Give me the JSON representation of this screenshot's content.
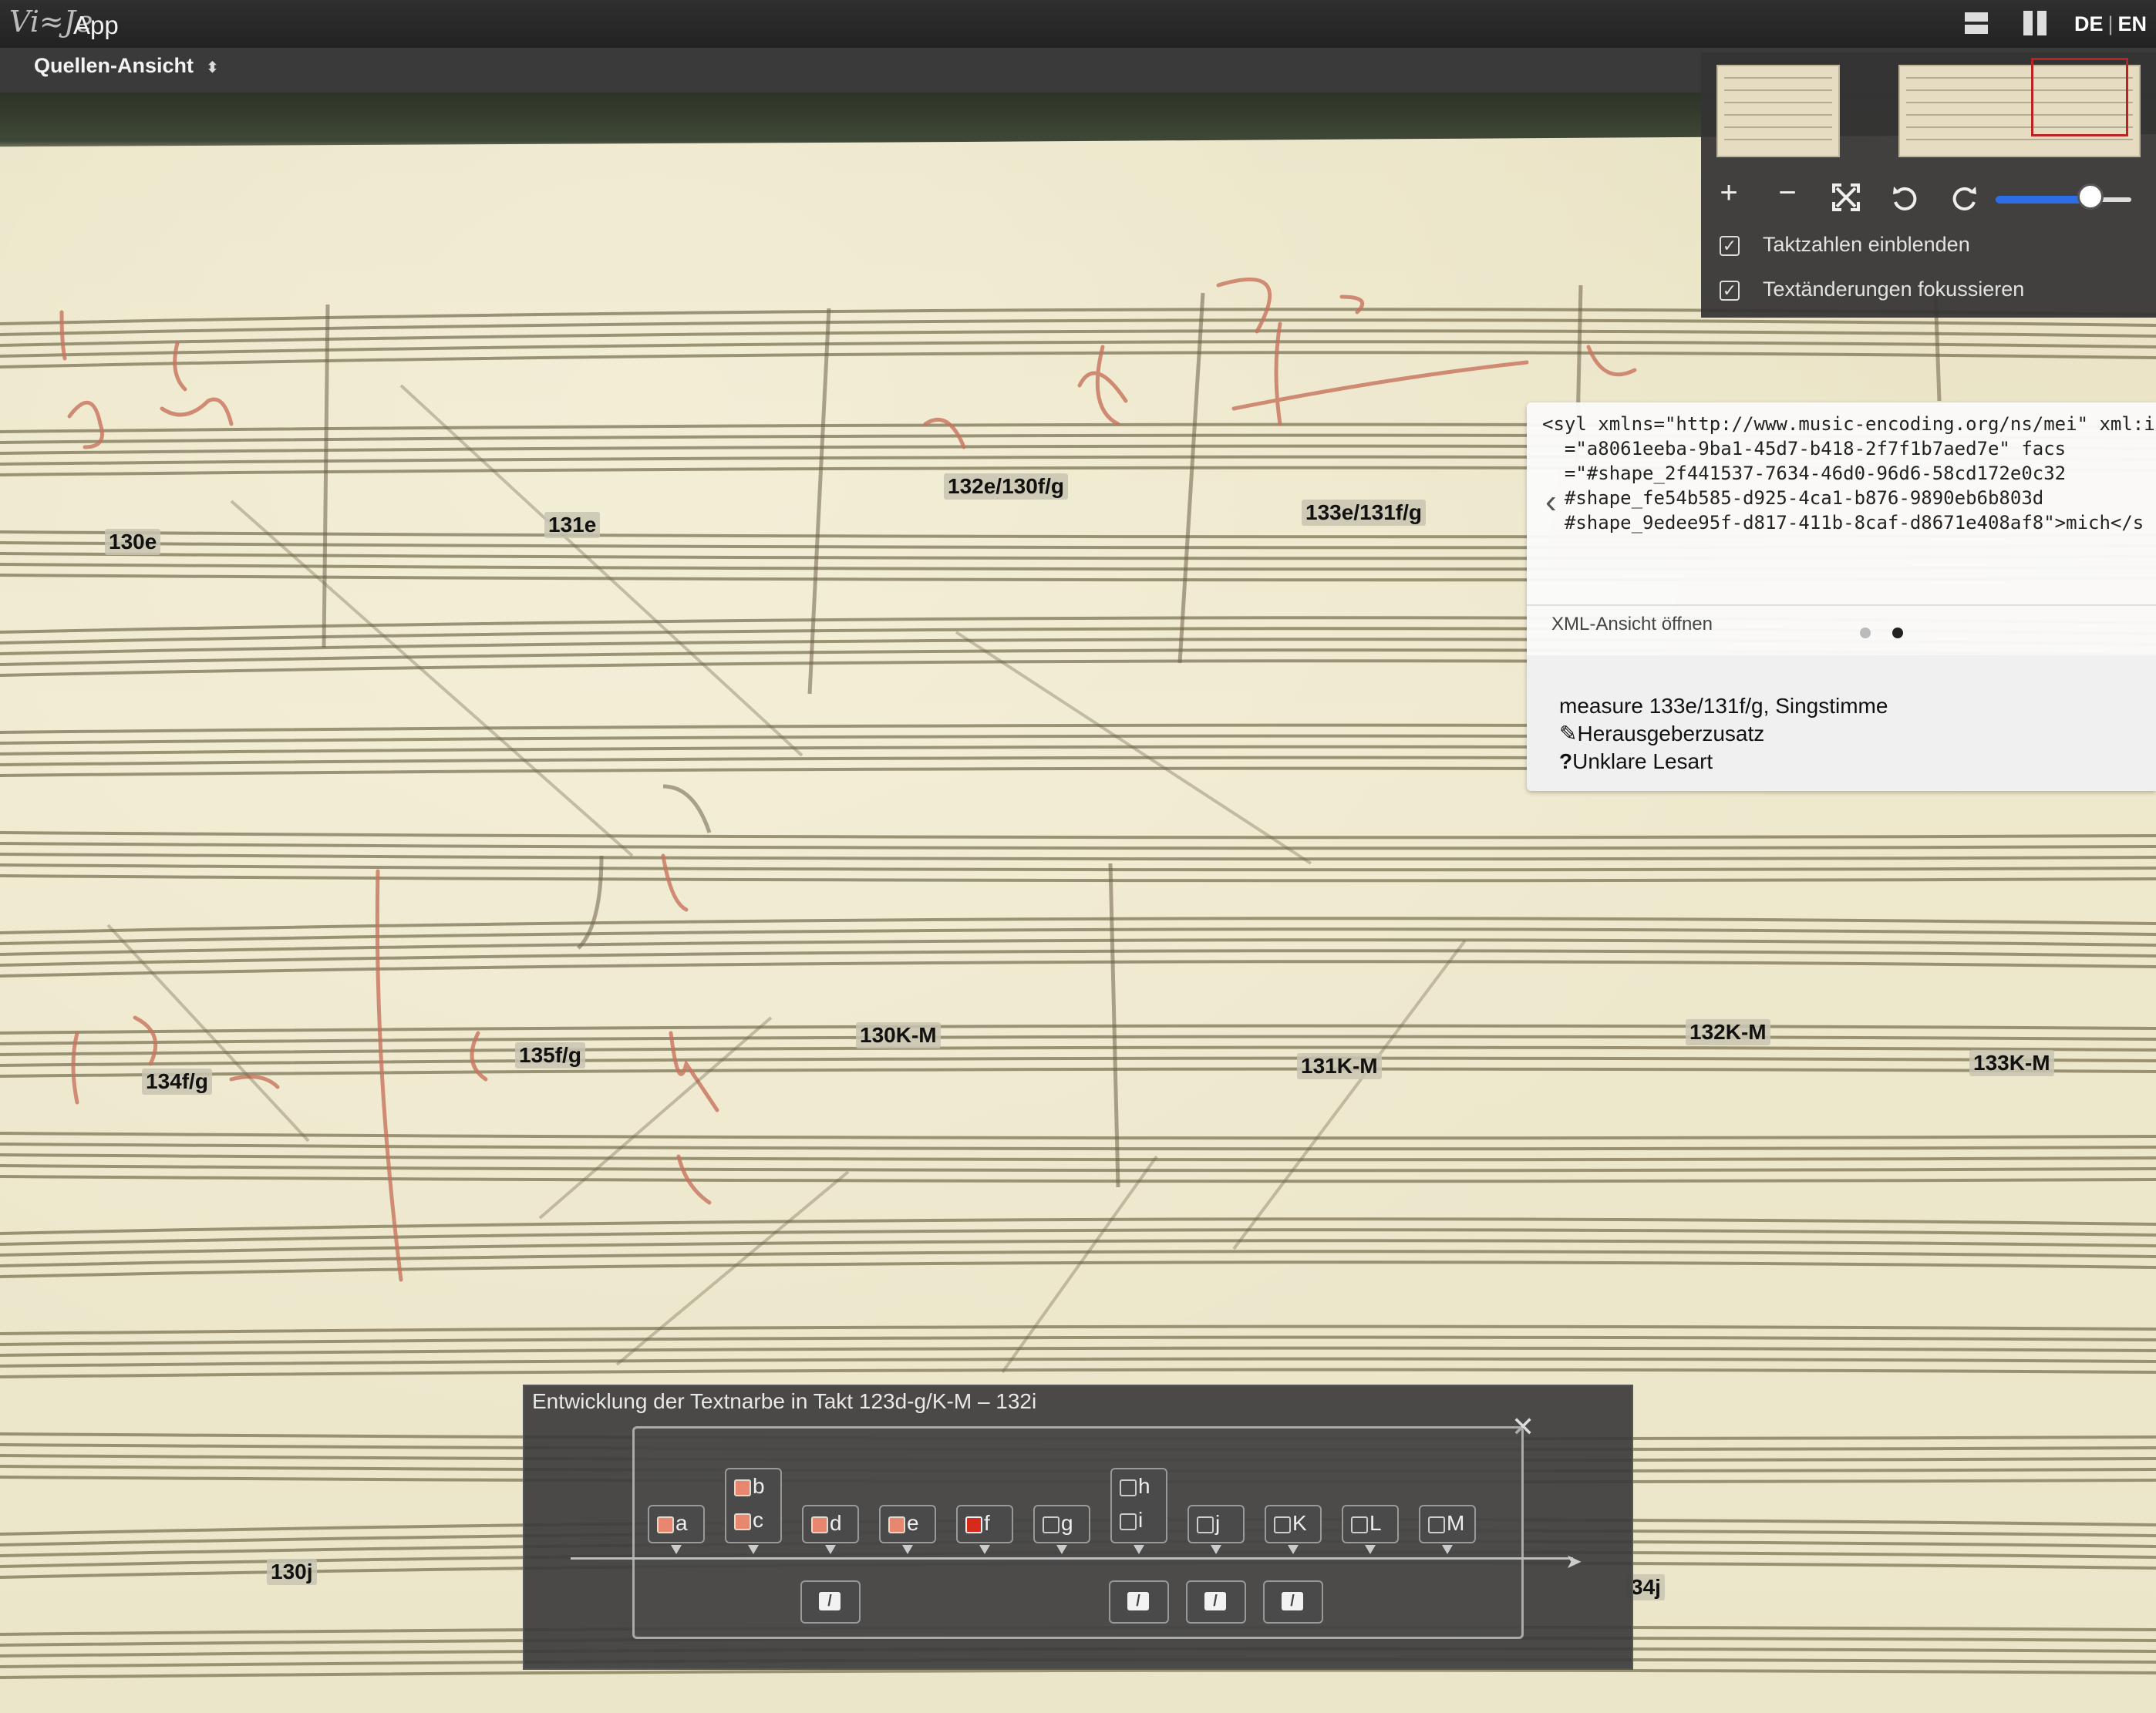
{
  "app": {
    "logo": "Vi≈Je",
    "title": "App"
  },
  "header": {
    "lang_de": "DE",
    "lang_en": "EN",
    "view_select": "Quellen-Ansicht"
  },
  "nav": {
    "checkbox1": "Taktzahlen einblenden",
    "checkbox2": "Textänderungen fokussieren",
    "zoom_level": 0.7
  },
  "measures": [
    {
      "label": "130e"
    },
    {
      "label": "131e"
    },
    {
      "label": "132e/130f/g"
    },
    {
      "label": "133e/131f/g"
    },
    {
      "label": "134f/g"
    },
    {
      "label": "135f/g"
    },
    {
      "label": "130K-M"
    },
    {
      "label": "131K-M"
    },
    {
      "label": "132K-M"
    },
    {
      "label": "133K-M"
    },
    {
      "label": "130j"
    },
    {
      "label": "34j"
    }
  ],
  "xml": {
    "lines": [
      "<syl xmlns=\"http://www.music-encoding.org/ns/mei\" xml:id",
      "  =\"a8061eeba-9ba1-45d7-b418-2f7f1b7aed7e\" facs",
      "  =\"#shape_2f441537-7634-46d0-96d6-58cd172e0c32",
      "  #shape_fe54b585-d925-4ca1-b876-9890eb6b803d",
      "  #shape_9edee95f-d817-411b-8caf-d8671e408af8\">mich</s"
    ],
    "open_label": "XML-Ansicht öffnen",
    "measure_info": "measure 133e/131f/g, Singstimme",
    "note1": "Herausgeberzusatz",
    "note2": "Unklare Lesart"
  },
  "variant": {
    "title": "Entwicklung der Textnarbe in Takt 123d-g/K-M – 132i",
    "nodes": [
      {
        "labels": [
          "a"
        ],
        "states": [
          "fill"
        ]
      },
      {
        "labels": [
          "b",
          "c"
        ],
        "states": [
          "fill",
          "fill"
        ]
      },
      {
        "labels": [
          "d"
        ],
        "states": [
          "fill"
        ]
      },
      {
        "labels": [
          "e"
        ],
        "states": [
          "fill"
        ]
      },
      {
        "labels": [
          "f"
        ],
        "states": [
          "red"
        ]
      },
      {
        "labels": [
          "g"
        ],
        "states": [
          "empty"
        ]
      },
      {
        "labels": [
          "h",
          "i"
        ],
        "states": [
          "empty",
          "empty"
        ]
      },
      {
        "labels": [
          "j"
        ],
        "states": [
          "empty"
        ]
      },
      {
        "labels": [
          "K"
        ],
        "states": [
          "empty"
        ]
      },
      {
        "labels": [
          "L"
        ],
        "states": [
          "empty"
        ]
      },
      {
        "labels": [
          "M"
        ],
        "states": [
          "empty"
        ]
      }
    ]
  },
  "colors": {
    "accent": "#2d6de8",
    "topbar": "#2a2a2a",
    "highlight": "#d62a1a",
    "paper": "#ece6ca",
    "ink": "#c86c5a"
  }
}
